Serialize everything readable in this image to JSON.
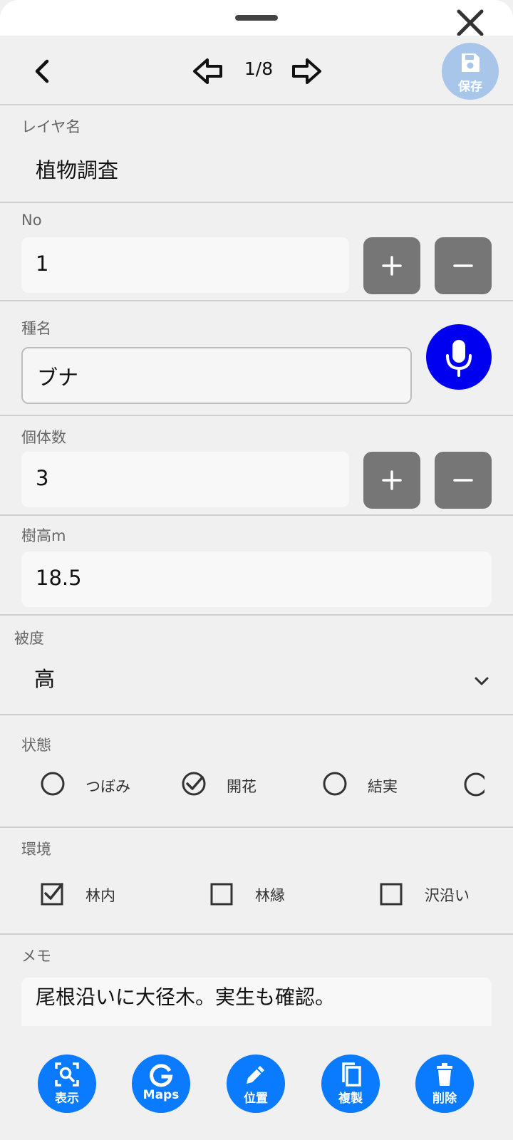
{
  "header": {
    "counter": "1/8",
    "save_label": "保存"
  },
  "layer": {
    "label": "レイヤ名",
    "value": "植物調査"
  },
  "no": {
    "label": "No",
    "value": "1"
  },
  "species": {
    "label": "種名",
    "value": "ブナ"
  },
  "count": {
    "label": "個体数",
    "value": "3"
  },
  "height": {
    "label": "樹高m",
    "value": "18.5"
  },
  "coverage": {
    "label": "被度",
    "value": "高"
  },
  "state": {
    "label": "状態",
    "options": [
      {
        "label": "つぼみ",
        "checked": false
      },
      {
        "label": "開花",
        "checked": true
      },
      {
        "label": "結実",
        "checked": false
      }
    ]
  },
  "environment": {
    "label": "環境",
    "options": [
      {
        "label": "林内",
        "checked": true
      },
      {
        "label": "林縁",
        "checked": false
      },
      {
        "label": "沢沿い",
        "checked": false
      }
    ]
  },
  "memo": {
    "label": "メモ",
    "value": "尾根沿いに大径木。実生も確認。"
  },
  "toolbar": {
    "view_label": "表示",
    "maps_label": "Maps",
    "position_label": "位置",
    "duplicate_label": "複製",
    "delete_label": "削除"
  },
  "colors": {
    "accent": "#0a7aff",
    "mic": "#0000f0",
    "stepper": "#767676",
    "save_disabled": "#a7c6e9"
  }
}
